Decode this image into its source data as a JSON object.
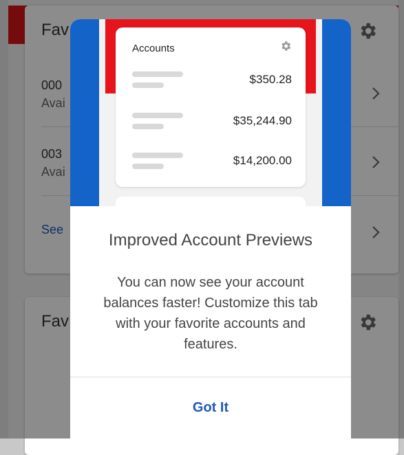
{
  "background": {
    "card1": {
      "title": "Fav",
      "gear_icon": "gear-icon",
      "accounts": [
        {
          "number": "000",
          "available_label": "Avai"
        },
        {
          "number": "003",
          "available_label": "Avai"
        }
      ],
      "see_link": "See"
    },
    "card2": {
      "title": "Fav",
      "gear_icon": "gear-icon"
    }
  },
  "dialog": {
    "preview": {
      "title": "Accounts",
      "gear_icon": "gear-icon",
      "amounts": [
        "$350.28",
        "$35,244.90",
        "$14,200.00"
      ]
    },
    "title": "Improved Account Previews",
    "body": "You can now see your account balances faster! Customize this tab with your favorite accounts and features.",
    "button_label": "Got It"
  },
  "colors": {
    "brand_red": "#e8141b",
    "brand_blue": "#1463c8",
    "link_blue": "#1f5ab8"
  }
}
